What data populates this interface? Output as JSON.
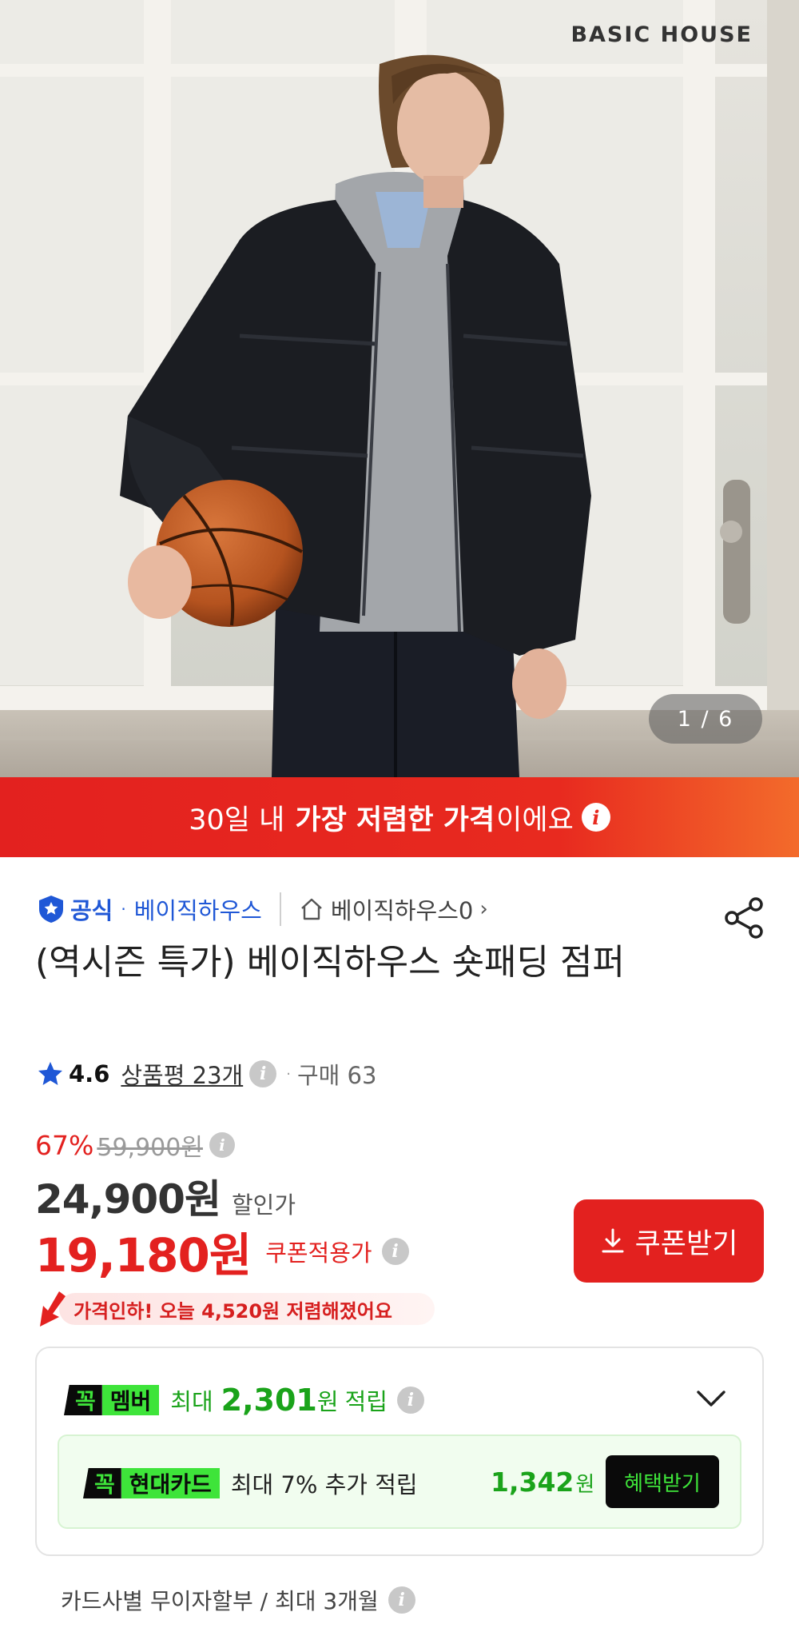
{
  "hero": {
    "brand_mark": "BASIC HOUSE",
    "pager": "1 / 6"
  },
  "lowest_banner": {
    "prefix": "30일 내 ",
    "highlight": "가장 저렴한 가격",
    "suffix": "이에요",
    "info_glyph": "i"
  },
  "seller": {
    "official_label": "공식",
    "separator": "·",
    "name": "베이직하우스",
    "store_link": "베이직하우스0",
    "chevron": "›"
  },
  "product": {
    "title": "(역시즌 특가) 베이직하우스 숏패딩 점퍼"
  },
  "rating": {
    "score": "4.6",
    "reviews": "상품평 23개",
    "separator": "·",
    "purchases": "구매 63"
  },
  "price": {
    "discount_pct": "67%",
    "original": "59,900원",
    "sale": "24,900원",
    "sale_label": "할인가",
    "coupon_price": "19,180원",
    "coupon_label": "쿠폰적용가",
    "coupon_button": "쿠폰받기",
    "drop_notice": "가격인하! 오늘 4,520원 저렴해졌어요"
  },
  "membership": {
    "tag_kkok": "꼭",
    "tag_member": "멤버",
    "max_label": "최대",
    "points": "2,301",
    "unit": "원",
    "accrue_label": "적립",
    "card": {
      "tag_kkok": "꼭",
      "tag_card": "현대카드",
      "desc": "최대 7% 추가 적립",
      "points": "1,342",
      "unit": "원",
      "button": "혜택받기"
    }
  },
  "installment": {
    "text": "카드사별 무이자할부 / 최대 3개월"
  },
  "colors": {
    "accent_red": "#e3211f",
    "official_blue": "#1f57d6",
    "member_green": "#1aa31a",
    "kkok_lime": "#3ee43a"
  },
  "icons": [
    "shield-check-icon",
    "home-icon",
    "share-icon",
    "star-icon",
    "info-icon",
    "download-icon",
    "price-drop-arrow-icon",
    "chevron-down-icon"
  ]
}
